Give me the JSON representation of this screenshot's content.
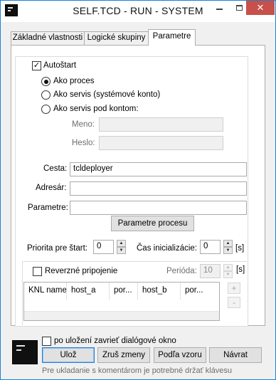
{
  "window": {
    "title": "SELF.TCD - RUN - SYSTEM",
    "close_glyph": "✕"
  },
  "tabs": [
    {
      "label": "Základné vlastnosti",
      "active": false
    },
    {
      "label": "Logické skupiny",
      "active": false
    },
    {
      "label": "Parametre",
      "active": true
    }
  ],
  "autostart": {
    "label": "Autoštart",
    "checked": true
  },
  "run_mode": {
    "options": [
      {
        "label": "Ako proces",
        "selected": true
      },
      {
        "label": "Ako servis (systémové konto)",
        "selected": false
      },
      {
        "label": "Ako servis pod kontom:",
        "selected": false
      }
    ],
    "name_label": "Meno:",
    "name_value": "",
    "password_label": "Heslo:",
    "password_value": ""
  },
  "paths": {
    "path_label": "Cesta:",
    "path_value": "tcldeployer",
    "dir_label": "Adresár:",
    "dir_value": "",
    "params_label": "Parametre:",
    "params_value": "",
    "process_params_button": "Parametre procesu"
  },
  "priority": {
    "label": "Priorita pre štart:",
    "value": "0",
    "init_time_label": "Čas inicializácie:",
    "init_time_value": "0",
    "unit": "[s]"
  },
  "reverse": {
    "label": "Reverzné pripojenie",
    "checked": false,
    "period_label": "Perióda:",
    "period_value": "10",
    "unit": "[s]"
  },
  "grid": {
    "columns": [
      "KNL name",
      "host_a",
      "por...",
      "host_b",
      "por..."
    ],
    "rows": [],
    "add_glyph": "+",
    "remove_glyph": "-"
  },
  "footer": {
    "close_after_save_label": "po uložení zavrieť dialógové okno",
    "close_after_save_checked": false,
    "save_button": "Ulož",
    "discard_button": "Zruš zmeny",
    "template_button": "Podľa vzoru",
    "back_button": "Návrat",
    "hint": "Pre ukladanie s komentárom je potrebné držať klávesu"
  },
  "icons": {
    "app": "terminal-icon",
    "spin_up": "▲",
    "spin_down": "▼",
    "check": "✓"
  },
  "colors": {
    "accent": "#1883d7",
    "close_button": "#c7504a",
    "primary_border": "#2b7bd5",
    "disabled_text": "#6d6d6d"
  }
}
